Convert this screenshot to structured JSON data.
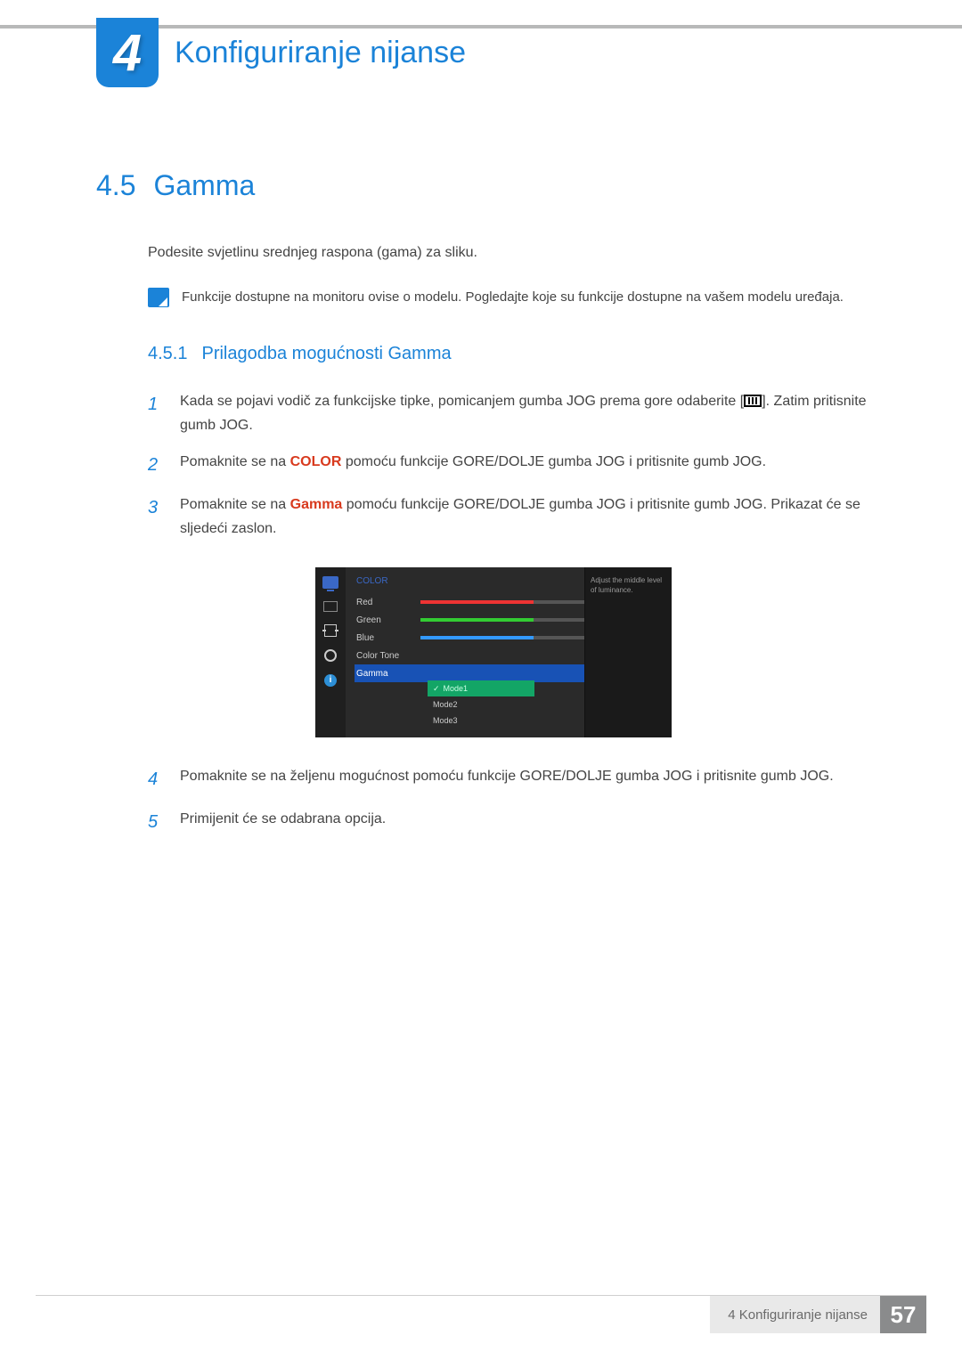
{
  "chapter": {
    "number": "4",
    "title": "Konfiguriranje nijanse"
  },
  "section": {
    "number": "4.5",
    "title": "Gamma"
  },
  "intro": "Podesite svjetlinu srednjeg raspona (gama) za sliku.",
  "note": "Funkcije dostupne na monitoru ovise o modelu. Pogledajte koje su funkcije dostupne na vašem modelu uređaja.",
  "subsection": {
    "number": "4.5.1",
    "title": "Prilagodba mogućnosti Gamma"
  },
  "steps": {
    "s1a": "Kada se pojavi vodič za funkcijske tipke, pomicanjem gumba JOG prema gore odaberite [",
    "s1b": "]. Zatim pritisnite gumb JOG.",
    "s2a": "Pomaknite se na ",
    "s2_kw": "COLOR",
    "s2b": " pomoću funkcije GORE/DOLJE gumba JOG i pritisnite gumb JOG.",
    "s3a": "Pomaknite se na ",
    "s3_kw": "Gamma",
    "s3b": " pomoću funkcije GORE/DOLJE gumba JOG i pritisnite gumb JOG. Prikazat će se sljedeći zaslon.",
    "s4": "Pomaknite se na željenu mogućnost pomoću funkcije GORE/DOLJE gumba JOG i pritisnite gumb JOG.",
    "s5": "Primijenit će se odabrana opcija.",
    "n1": "1",
    "n2": "2",
    "n3": "3",
    "n4": "4",
    "n5": "5"
  },
  "osd": {
    "title": "COLOR",
    "rows": {
      "red": {
        "label": "Red",
        "value": "50",
        "pct": 50,
        "color": "#e33"
      },
      "green": {
        "label": "Green",
        "value": "50",
        "pct": 50,
        "color": "#3c3"
      },
      "blue": {
        "label": "Blue",
        "value": "50",
        "pct": 50,
        "color": "#39f"
      },
      "tone": {
        "label": "Color Tone"
      },
      "gamma": {
        "label": "Gamma"
      }
    },
    "gamma_options": {
      "m1": "Mode1",
      "m2": "Mode2",
      "m3": "Mode3"
    },
    "desc": "Adjust the middle level of luminance.",
    "info_glyph": "i"
  },
  "footer": {
    "text": "4 Konfiguriranje nijanse",
    "page": "57"
  }
}
